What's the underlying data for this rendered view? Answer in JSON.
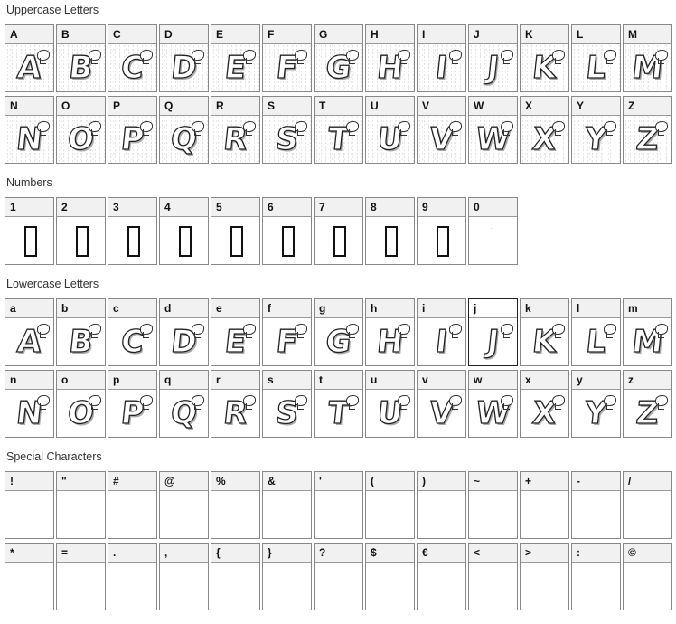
{
  "sections": {
    "uppercase": {
      "title": "Uppercase Letters",
      "rows": [
        [
          "A",
          "B",
          "C",
          "D",
          "E",
          "F",
          "G",
          "H",
          "I",
          "J",
          "K",
          "L",
          "M"
        ],
        [
          "N",
          "O",
          "P",
          "Q",
          "R",
          "S",
          "T",
          "U",
          "V",
          "W",
          "X",
          "Y",
          "Z"
        ]
      ]
    },
    "numbers": {
      "title": "Numbers",
      "rows": [
        [
          "1",
          "2",
          "3",
          "4",
          "5",
          "6",
          "7",
          "8",
          "9",
          "0"
        ]
      ]
    },
    "lowercase": {
      "title": "Lowercase Letters",
      "rows": [
        [
          "a",
          "b",
          "c",
          "d",
          "e",
          "f",
          "g",
          "h",
          "i",
          "j",
          "k",
          "l",
          "m"
        ],
        [
          "n",
          "o",
          "p",
          "q",
          "r",
          "s",
          "t",
          "u",
          "v",
          "w",
          "x",
          "y",
          "z"
        ]
      ],
      "highlighted": "j"
    },
    "special": {
      "title": "Special Characters",
      "rows": [
        [
          "!",
          "\"",
          "#",
          "@",
          "%",
          "&",
          "'",
          "(",
          ")",
          "~",
          "+",
          "-",
          "/"
        ],
        [
          "*",
          "=",
          ".",
          ",",
          "{",
          "}",
          "?",
          "$",
          "€",
          "<",
          ">",
          ":",
          "©"
        ]
      ]
    }
  }
}
